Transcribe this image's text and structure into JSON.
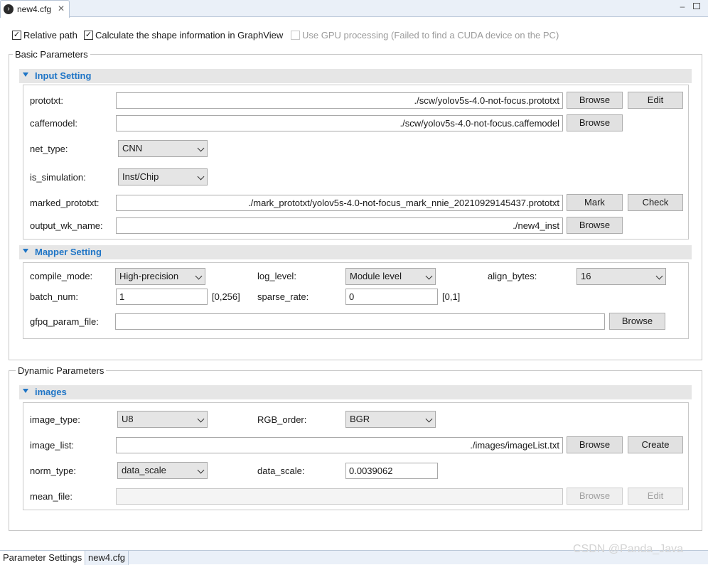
{
  "editor_tab": {
    "title": "new4.cfg",
    "close": "✕"
  },
  "options": {
    "relative_path": {
      "label": "Relative path",
      "checked": "✓"
    },
    "calc_shape": {
      "label": "Calculate the shape information in GraphView",
      "checked": "✓"
    },
    "use_gpu": {
      "label": "Use GPU processing (Failed to find a CUDA device on the PC)",
      "checked": ""
    }
  },
  "basic": {
    "legend": "Basic Parameters",
    "input_setting": {
      "title": "Input Setting",
      "prototxt": {
        "label": "prototxt:",
        "value": "./scw/yolov5s-4.0-not-focus.prototxt",
        "browse": "Browse",
        "edit": "Edit"
      },
      "caffemodel": {
        "label": "caffemodel:",
        "value": "./scw/yolov5s-4.0-not-focus.caffemodel",
        "browse": "Browse"
      },
      "net_type": {
        "label": "net_type:",
        "value": "CNN"
      },
      "is_simulation": {
        "label": "is_simulation:",
        "value": "Inst/Chip"
      },
      "marked_prototxt": {
        "label": "marked_prototxt:",
        "value": "./mark_prototxt/yolov5s-4.0-not-focus_mark_nnie_20210929145437.prototxt",
        "mark": "Mark",
        "check": "Check"
      },
      "output_wk_name": {
        "label": "output_wk_name:",
        "value": "./new4_inst",
        "browse": "Browse"
      }
    },
    "mapper_setting": {
      "title": "Mapper Setting",
      "compile_mode": {
        "label": "compile_mode:",
        "value": "High-precision"
      },
      "log_level": {
        "label": "log_level:",
        "value": "Module level"
      },
      "align_bytes": {
        "label": "align_bytes:",
        "value": "16"
      },
      "batch_num": {
        "label": "batch_num:",
        "value": "1",
        "range": "[0,256]"
      },
      "sparse_rate": {
        "label": "sparse_rate:",
        "value": "0",
        "range": "[0,1]"
      },
      "gfpq_param_file": {
        "label": "gfpq_param_file:",
        "value": "",
        "browse": "Browse"
      }
    }
  },
  "dynamic": {
    "legend": "Dynamic Parameters",
    "images": {
      "title": "images",
      "image_type": {
        "label": "image_type:",
        "value": "U8"
      },
      "rgb_order": {
        "label": "RGB_order:",
        "value": "BGR"
      },
      "image_list": {
        "label": "image_list:",
        "value": "./images/imageList.txt",
        "browse": "Browse",
        "create": "Create"
      },
      "norm_type": {
        "label": "norm_type:",
        "value": "data_scale"
      },
      "data_scale": {
        "label": "data_scale:",
        "value": "0.0039062"
      },
      "mean_file": {
        "label": "mean_file:",
        "value": "",
        "browse": "Browse",
        "edit": "Edit"
      }
    }
  },
  "bottom_tabs": [
    "Parameter Settings",
    "new4.cfg"
  ],
  "watermark": "CSDN @Panda_Java",
  "colors": {
    "section_title": "#1f75c6",
    "tab_bar": "#eaf0f8"
  }
}
